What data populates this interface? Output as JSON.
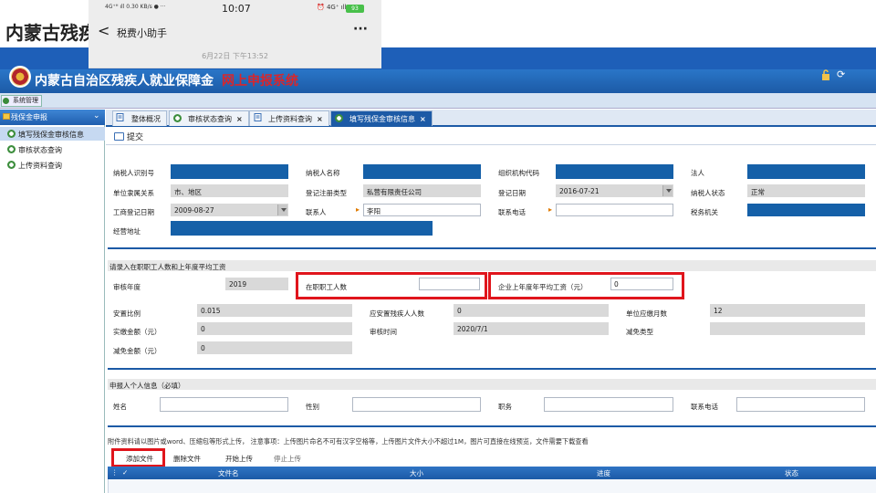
{
  "deck_title": "内蒙古残疾人",
  "phone": {
    "signal": "4G⁺ᴴ ıll 0.30 KB/s ● ···",
    "time": "10:07",
    "status": "⏰ 4G⁺ ıll",
    "battery": "93",
    "back": "<",
    "chat_title": "税费小助手",
    "more": "···",
    "date": "6月22日 下午13:52"
  },
  "app": {
    "title": "内蒙古自治区残疾人就业保障金",
    "subtitle": "网上申报系统",
    "refresh": "⟳"
  },
  "menubar": {
    "system_mgmt": "系统管理"
  },
  "sidebar": {
    "header": "残保金申报",
    "chevron": "⌄",
    "items": [
      {
        "label": "填写残保金审核信息",
        "active": true
      },
      {
        "label": "审核状态查询",
        "active": false
      },
      {
        "label": "上传资料查询",
        "active": false
      }
    ]
  },
  "tabs": [
    {
      "label": "整体概况",
      "close": ""
    },
    {
      "label": "审核状态查询",
      "close": "×"
    },
    {
      "label": "上传资料查询",
      "close": "×"
    },
    {
      "label": "填写残保金审核信息",
      "close": "×"
    }
  ],
  "toolbar": {
    "submit": "提交"
  },
  "taxpayer": {
    "id_label": "纳税人识别号",
    "name_label": "纳税人名称",
    "org_code_label": "组织机构代码",
    "legal_label": "法人",
    "affiliation_label": "单位隶属关系",
    "affiliation_value": "市、地区",
    "reg_type_label": "登记注册类型",
    "reg_type_value": "私营有限责任公司",
    "reg_date_label": "登记日期",
    "reg_date_value": "2016-07-21",
    "status_label": "纳税人状态",
    "status_value": "正常",
    "biz_reg_date_label": "工商登记日期",
    "biz_reg_date_value": "2009-08-27",
    "contact_label": "联系人",
    "contact_value": "李阳",
    "phone_label": "联系电话",
    "phone_value": "",
    "tax_office_label": "税务机关",
    "address_label": "经营地址"
  },
  "employees": {
    "section_title": "请录入在职职工人数和上年度平均工资",
    "year_label": "审核年度",
    "year_value": "2019",
    "staff_label": "在职职工人数",
    "staff_value": "",
    "salary_label": "企业上年度年平均工资（元）",
    "salary_value": "0",
    "ratio_label": "安置比例",
    "ratio_value": "0.015",
    "disabled_label": "应安置残疾人人数",
    "disabled_value": "0",
    "months_label": "单位应缴月数",
    "months_value": "12",
    "paid_label": "实缴金额（元）",
    "paid_value": "0",
    "review_time_label": "审核时间",
    "review_time_value": "2020/7/1",
    "exempt_type_label": "减免类型",
    "exempt_type_value": "",
    "exempt_amount_label": "减免金额（元）",
    "exempt_amount_value": "0"
  },
  "applicant": {
    "section_title": "申报人个人信息（必填）",
    "name_label": "姓名",
    "gender_label": "性别",
    "position_label": "职务",
    "phone_label": "联系电话"
  },
  "attachments": {
    "note": "附件资料请以图片或word、压缩包等形式上传，  注意事项：上传图片命名不可有汉字空格等，上传图片文件大小不超过1M，图片可直接在线预览，文件需要下载查看",
    "add_file": "添加文件",
    "delete_file": "删除文件",
    "start_upload": "开始上传",
    "stop_upload": "停止上传",
    "columns": [
      "文件名",
      "大小",
      "进度",
      "状态"
    ],
    "select_all": "✓"
  },
  "colors": {
    "accent": "#1c5aa6",
    "highlight": "#e0151c",
    "title_red": "#d9262b"
  }
}
